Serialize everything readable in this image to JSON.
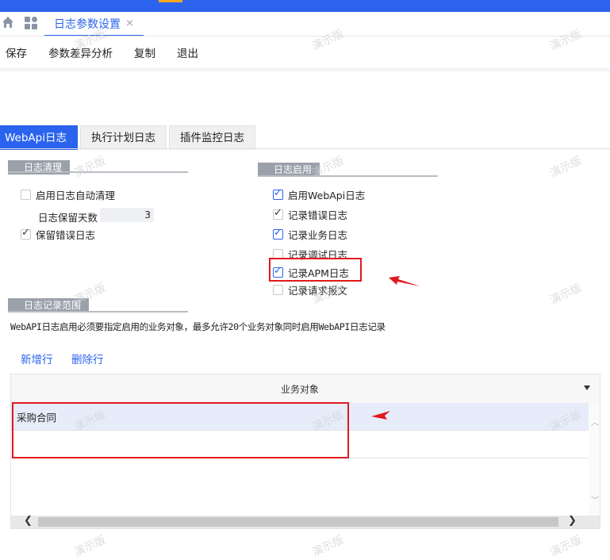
{
  "header": {
    "tab_label": "日志参数设置",
    "tab_close": "×"
  },
  "toolbar": {
    "items": [
      "保存",
      "参数差异分析",
      "复制",
      "退出"
    ]
  },
  "tabs": [
    "WebApi日志",
    "执行计划日志",
    "插件监控日志"
  ],
  "cleanup": {
    "title": "日志清理",
    "auto_clean_label": "启用日志自动清理",
    "auto_clean_checked": false,
    "retain_days_label": "日志保留天数",
    "retain_days_value": "3",
    "keep_error_label": "保留错误日志",
    "keep_error_checked": true
  },
  "enable": {
    "title": "日志启用",
    "items": [
      {
        "label": "启用WebApi日志",
        "checked": true
      },
      {
        "label": "记录错误日志",
        "checked": true
      },
      {
        "label": "记录业务日志",
        "checked": true
      },
      {
        "label": "记录调试日志",
        "checked": false
      },
      {
        "label": "记录APM日志",
        "checked": true
      },
      {
        "label": "记录请求报文",
        "checked": false
      }
    ]
  },
  "scope": {
    "title": "日志记录范围",
    "description": "WebAPI日志启用必须要指定启用的业务对象，最多允许20个业务对象同时启用WebAPI日志记录",
    "add_row": "新增行",
    "delete_row": "删除行",
    "column_header": "业务对象",
    "rows": [
      "采购合同"
    ]
  },
  "watermark": "演示版",
  "colors": {
    "accent": "#2b63ee",
    "annotation": "#e0191e"
  }
}
